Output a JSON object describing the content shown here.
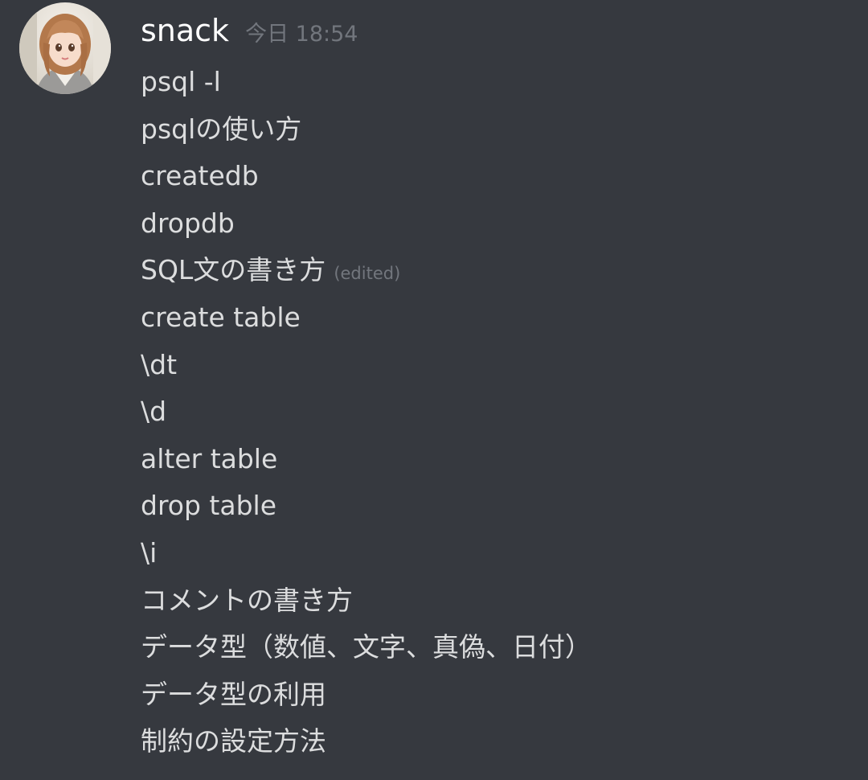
{
  "message": {
    "author": "snack",
    "timestamp": "今日 18:54",
    "avatar_icon": "user-avatar",
    "lines": [
      {
        "text": "psql -l"
      },
      {
        "text": "psqlの使い方"
      },
      {
        "text": "createdb"
      },
      {
        "text": "dropdb"
      },
      {
        "text": "SQL文の書き方",
        "edited": "(edited)"
      },
      {
        "text": "create table"
      },
      {
        "text": "\\dt"
      },
      {
        "text": "\\d"
      },
      {
        "text": "alter table"
      },
      {
        "text": "drop table"
      },
      {
        "text": "\\i"
      },
      {
        "text": "コメントの書き方"
      },
      {
        "text": "データ型（数値、文字、真偽、日付）"
      },
      {
        "text": "データ型の利用"
      },
      {
        "text": "制約の設定方法"
      }
    ]
  },
  "colors": {
    "background": "#36393f",
    "username": "#ffffff",
    "message_text": "#dcddde",
    "muted": "#72767d"
  }
}
